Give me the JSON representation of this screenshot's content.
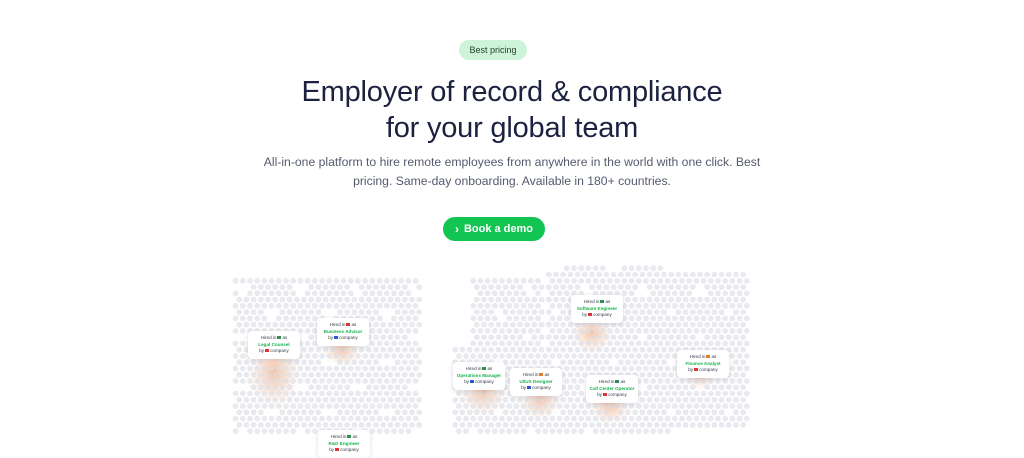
{
  "hero": {
    "badge": "Best pricing",
    "title_line1": "Employer of record & compliance",
    "title_line2": "for your global team",
    "subtitle_line1": "All-in-one platform to hire remote employees from anywhere in the world with one click. Best",
    "subtitle_line2": "pricing. Same-day onboarding. Available in 180+ countries.",
    "cta_label": "Book a demo",
    "cta_icon": "chevron-right-icon"
  },
  "colors": {
    "accent_green": "#12c451",
    "badge_bg": "#cdf3d8",
    "heading": "#1c2140",
    "map_dot": "#dcdfe6",
    "heat": "#f6a97d"
  },
  "hire_cards": [
    {
      "hired": "Hired in",
      "as": "as",
      "role": "Legal Counsel",
      "by": "by",
      "company": "company",
      "flag": "#2f8f4f",
      "co_flag": "#d33"
    },
    {
      "hired": "Hired in",
      "as": "as",
      "role": "Business Advisor",
      "by": "by",
      "company": "company",
      "flag": "#d33",
      "co_flag": "#2a56c6"
    },
    {
      "hired": "Hired in",
      "as": "as",
      "role": "Software Engineer",
      "by": "by",
      "company": "company",
      "flag": "#2f8f4f",
      "co_flag": "#d33"
    },
    {
      "hired": "Hired in",
      "as": "as",
      "role": "Finance Analyst",
      "by": "by",
      "company": "company",
      "flag": "#e07b2a",
      "co_flag": "#d33"
    },
    {
      "hired": "Hired in",
      "as": "as",
      "role": "Operations Manager",
      "by": "by",
      "company": "company",
      "flag": "#2f8f4f",
      "co_flag": "#2a56c6"
    },
    {
      "hired": "Hired in",
      "as": "as",
      "role": "UI/UX Designer",
      "by": "by",
      "company": "company",
      "flag": "#e07b2a",
      "co_flag": "#2a56c6"
    },
    {
      "hired": "Hired in",
      "as": "as",
      "role": "Call Center Operator",
      "by": "by",
      "company": "company",
      "flag": "#2f8f4f",
      "co_flag": "#d33"
    },
    {
      "hired": "Hired in",
      "as": "as",
      "role": "R&D Engineer",
      "by": "by",
      "company": "company",
      "flag": "#2f8f4f",
      "co_flag": "#d33"
    }
  ]
}
